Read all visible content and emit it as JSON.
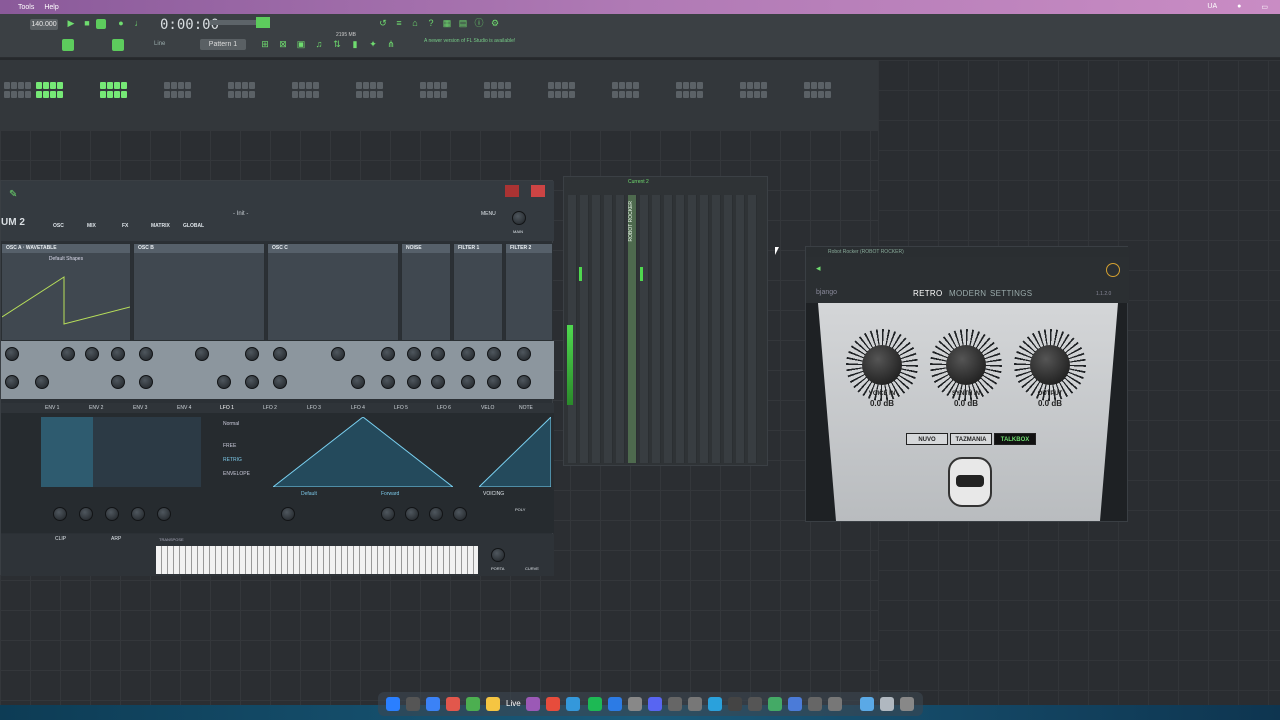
{
  "menubar": {
    "items": [
      "Tools",
      "Help"
    ],
    "status": "UA"
  },
  "toolbar": {
    "tempo": "140.000",
    "song_time": "0:00:00",
    "pattern": "Pattern 1",
    "snap": "Line",
    "cpu": "2195 MB",
    "hint": "A newer version of FL Studio is available!"
  },
  "serum": {
    "logo": "UM 2",
    "tabs": [
      "OSC",
      "MIX",
      "FX",
      "MATRIX",
      "GLOBAL"
    ],
    "preset": "- Init -",
    "menu": "MENU",
    "master": "MAIN",
    "osc_panels": [
      "OSC A",
      "OSC B",
      "OSC C",
      "NOISE",
      "FILTER 1",
      "FILTER 2"
    ],
    "wavetable_label": "WAVETABLE",
    "wavetable_name": "Default Shapes",
    "env_tabs": [
      "ENV 1",
      "ENV 2",
      "ENV 3",
      "ENV 4",
      "LFO 1",
      "LFO 2",
      "LFO 3",
      "LFO 4",
      "LFO 5",
      "LFO 6",
      "VELO",
      "NOTE"
    ],
    "lfo_mode": "Normal",
    "lfo_options": [
      "FREE",
      "RETRIG",
      "ENVELOPE"
    ],
    "lfo_shape": "Default",
    "lfo_dir": "Forward",
    "voicing": "VOICING",
    "poly": "POLY",
    "clip": "CLIP",
    "arp": "ARP",
    "transpose": "TRANSPOSE",
    "porta": "PORTA",
    "curve": "CURVE"
  },
  "mixer": {
    "title": "Current 2",
    "selected_track": "ROBOT ROCKER"
  },
  "robot_rocker": {
    "title": "Robot Rocker (ROBOT ROCKER)",
    "brand": "bjango",
    "tabs": [
      "RETRO",
      "MODERN",
      "SETTINGS"
    ],
    "version": "1.1.2.0",
    "knobs": [
      {
        "label": "VOICE IN",
        "value": "0.0 dB"
      },
      {
        "label": "SYNTH IN",
        "value": "0.0 dB"
      },
      {
        "label": "OUTPUT",
        "value": "0.0 dB"
      }
    ],
    "modes": [
      "NUVO",
      "TAZMANIA",
      "TALKBOX"
    ],
    "selected_mode": "TALKBOX"
  },
  "dock": {
    "live_label": "Live"
  },
  "colors": {
    "accent_green": "#5dcc5d",
    "serum_panel": "#404850",
    "robot_bg": "#1e2124"
  }
}
